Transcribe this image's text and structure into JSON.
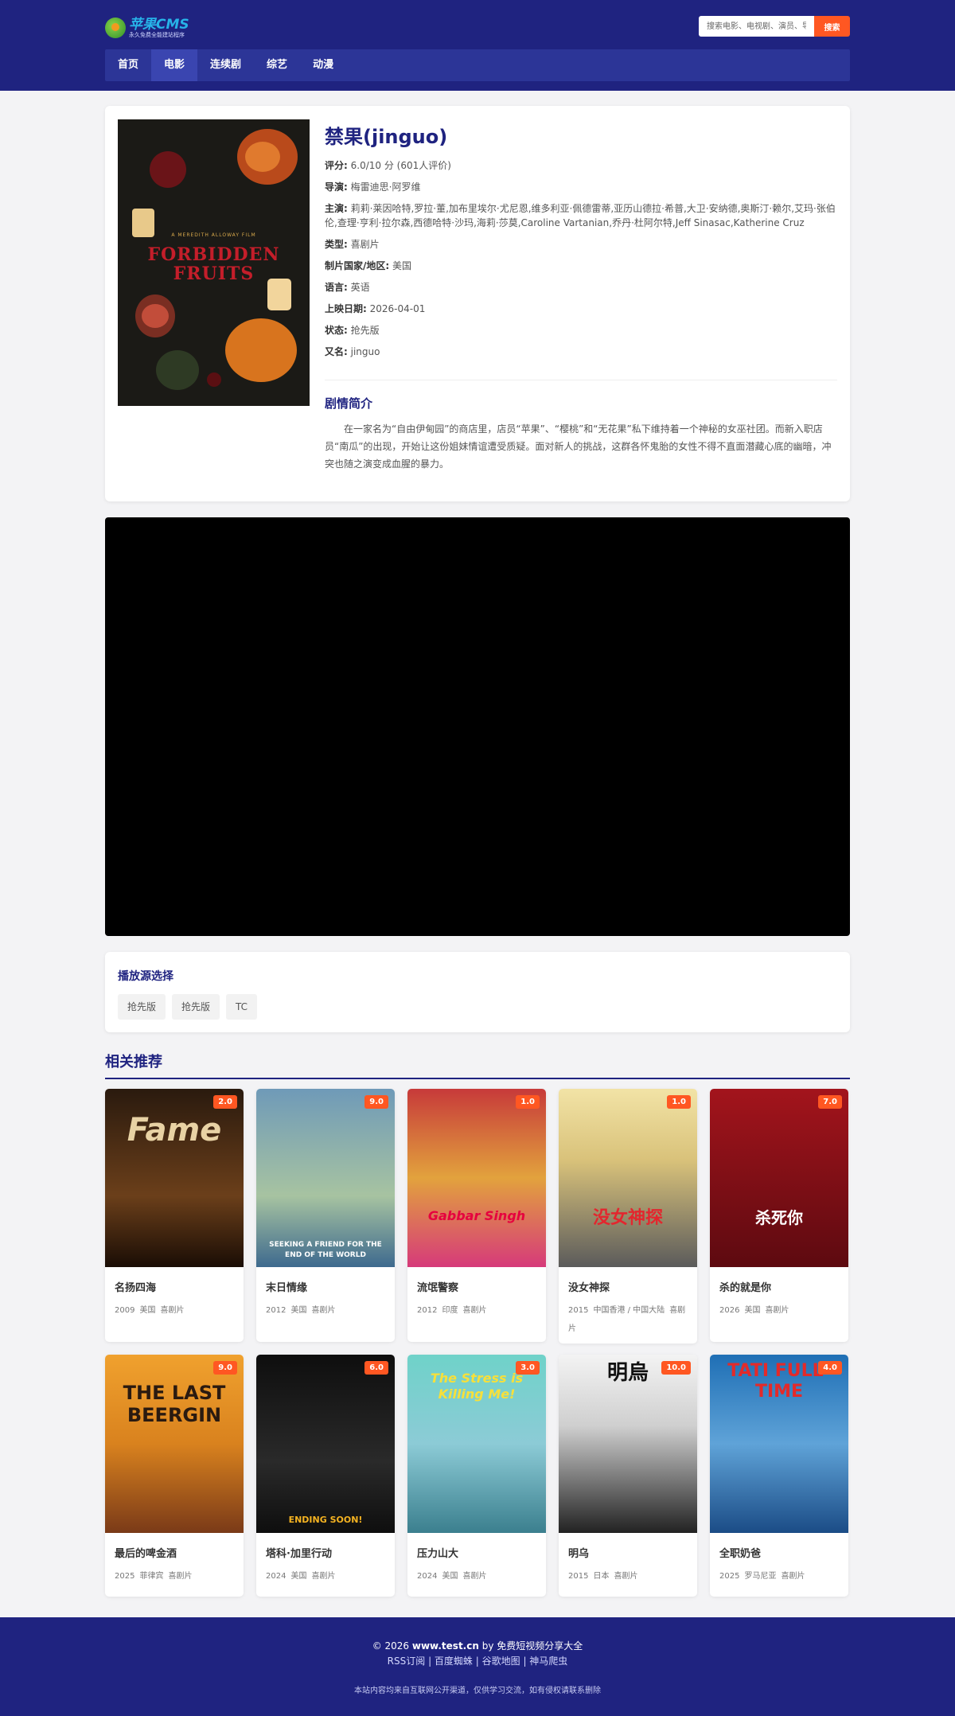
{
  "header": {
    "logo_main": "苹果CMS",
    "logo_sub": "永久免费全能建站程序",
    "search_placeholder": "搜索电影、电视剧、演员、导演",
    "search_button": "搜索",
    "nav": [
      {
        "label": "首页",
        "active": false
      },
      {
        "label": "电影",
        "active": true
      },
      {
        "label": "连续剧",
        "active": false
      },
      {
        "label": "综艺",
        "active": false
      },
      {
        "label": "动漫",
        "active": false
      }
    ]
  },
  "movie": {
    "title": "禁果(jinguo)",
    "poster_tag": "A MEREDITH ALLOWAY FILM",
    "poster_title": "FORBIDDEN FRUITS",
    "rows": [
      {
        "label": "评分:",
        "value": "6.0/10 分 (601人评价)"
      },
      {
        "label": "导演:",
        "value": "梅雷迪思·阿罗维"
      },
      {
        "label": "主演:",
        "value": "莉莉·莱因哈特,罗拉·董,加布里埃尔·尤尼恩,维多利亚·佩德雷蒂,亚历山德拉·希普,大卫·安纳德,奥斯汀·赖尔,艾玛·张伯伦,查理·亨利·拉尔森,西德哈特·沙玛,海莉·莎莫,Caroline Vartanian,乔丹·杜阿尔特,Jeff Sinasac,Katherine Cruz"
      },
      {
        "label": "类型:",
        "value": "喜剧片"
      },
      {
        "label": "制片国家/地区:",
        "value": "美国"
      },
      {
        "label": "语言:",
        "value": "英语"
      },
      {
        "label": "上映日期:",
        "value": "2026-04-01"
      },
      {
        "label": "状态:",
        "value": "抢先版"
      },
      {
        "label": "又名:",
        "value": "jinguo"
      }
    ],
    "plot_title": "剧情简介",
    "plot": "在一家名为“自由伊甸园”的商店里，店员“苹果”、“樱桃”和“无花果”私下维持着一个神秘的女巫社团。而新入职店员“南瓜”的出现，开始让这份姐妹情谊遭受质疑。面对新人的挑战，这群各怀鬼胎的女性不得不直面潜藏心底的幽暗，冲突也随之演变成血腥的暴力。"
  },
  "sources": {
    "title": "播放源选择",
    "items": [
      "抢先版",
      "抢先版",
      "TC"
    ]
  },
  "related": {
    "title": "相关推荐",
    "items": [
      {
        "title": "名扬四海",
        "year": "2009",
        "region": "美国",
        "genre": "喜剧片",
        "score": "2.0",
        "poster_text": "Fame"
      },
      {
        "title": "末日情缘",
        "year": "2012",
        "region": "美国",
        "genre": "喜剧片",
        "score": "9.0",
        "poster_text": "SEEKING A FRIEND FOR THE END OF THE WORLD"
      },
      {
        "title": "流氓警察",
        "year": "2012",
        "region": "印度",
        "genre": "喜剧片",
        "score": "1.0",
        "poster_text": "Gabbar Singh"
      },
      {
        "title": "没女神探",
        "year": "2015",
        "region": "中国香港 / 中国大陆",
        "genre": "喜剧片",
        "score": "1.0",
        "poster_text": "没女神探"
      },
      {
        "title": "杀的就是你",
        "year": "2026",
        "region": "美国",
        "genre": "喜剧片",
        "score": "7.0",
        "poster_text": "杀死你"
      },
      {
        "title": "最后的啤金酒",
        "year": "2025",
        "region": "菲律宾",
        "genre": "喜剧片",
        "score": "9.0",
        "poster_text": "THE LAST BEERGIN"
      },
      {
        "title": "塔科·加里行动",
        "year": "2024",
        "region": "美国",
        "genre": "喜剧片",
        "score": "6.0",
        "poster_text": "ENDING SOON!"
      },
      {
        "title": "压力山大",
        "year": "2024",
        "region": "美国",
        "genre": "喜剧片",
        "score": "3.0",
        "poster_text": "The Stress is Killing Me!"
      },
      {
        "title": "明乌",
        "year": "2015",
        "region": "日本",
        "genre": "喜剧片",
        "score": "10.0",
        "poster_text": "明烏"
      },
      {
        "title": "全职奶爸",
        "year": "2025",
        "region": "罗马尼亚",
        "genre": "喜剧片",
        "score": "4.0",
        "poster_text": "TATI FULL-TIME"
      }
    ]
  },
  "footer": {
    "copyright_prefix": "© 2026",
    "site": "www.test.cn",
    "by": "by",
    "site_name": "免费短视频分享大全",
    "links": [
      "RSS订阅",
      "百度蜘蛛",
      "谷歌地图",
      "神马爬虫"
    ],
    "disclaimer": "本站内容均来自互联网公开渠道，仅供学习交流，如有侵权请联系删除"
  }
}
